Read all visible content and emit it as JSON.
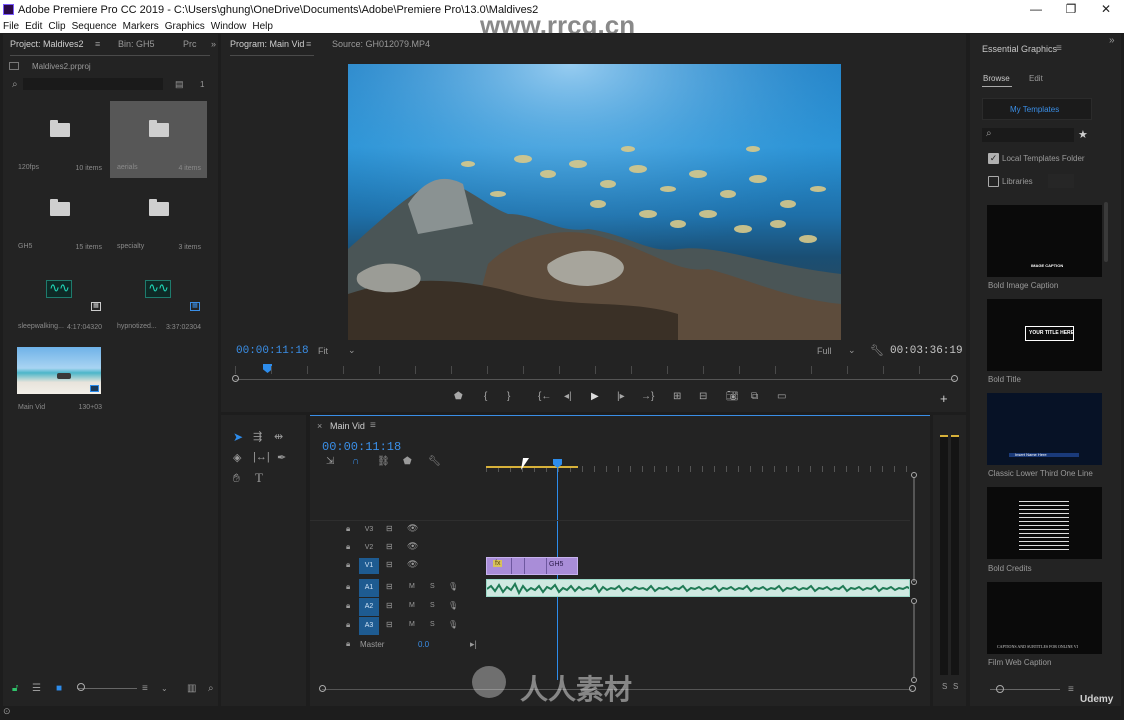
{
  "window": {
    "title": "Adobe Premiere Pro CC 2019 - C:\\Users\\ghung\\OneDrive\\Documents\\Adobe\\Premiere Pro\\13.0\\Maldives2",
    "minimize": "—",
    "restore": "❐",
    "close": "✕"
  },
  "menu": [
    "File",
    "Edit",
    "Clip",
    "Sequence",
    "Markers",
    "Graphics",
    "Window",
    "Help"
  ],
  "project": {
    "tabs": [
      "Project: Maldives2",
      "Bin: GH5",
      "Prc"
    ],
    "file": "Maldives2.prproj",
    "items_count": "1",
    "bins": [
      {
        "name": "120fps",
        "count": "10 items"
      },
      {
        "name": "aerials",
        "count": "4 items"
      },
      {
        "name": "GH5",
        "count": "15 items"
      },
      {
        "name": "specialty",
        "count": "3 items"
      },
      {
        "name": "sleepwalking...",
        "count": "4:17:04320"
      },
      {
        "name": "hypnotized...",
        "count": "3:37:02304"
      },
      {
        "name": "Main Vid",
        "count": "130+03"
      }
    ]
  },
  "program": {
    "tabs": [
      "Program: Main Vid",
      "Source: GH012079.MP4"
    ],
    "timecode": "00:00:11:18",
    "fit": "Fit",
    "quality": "Full",
    "duration": "00:03:36:19"
  },
  "timeline": {
    "tab": "Main Vid",
    "timecode": "00:00:11:18",
    "tracks": [
      {
        "label": "V3",
        "type": "video",
        "active": false
      },
      {
        "label": "V2",
        "type": "video",
        "active": false
      },
      {
        "label": "V1",
        "type": "video",
        "active": true
      },
      {
        "label": "A1",
        "type": "audio",
        "active": true
      },
      {
        "label": "A2",
        "type": "audio",
        "active": true
      },
      {
        "label": "A3",
        "type": "audio",
        "active": true
      }
    ],
    "master": {
      "label": "Master",
      "value": "0.0"
    },
    "clip_label": "GH5",
    "audio_mute": "M",
    "audio_solo": "S"
  },
  "essential_graphics": {
    "title": "Essential Graphics",
    "tabs": [
      "Browse",
      "Edit"
    ],
    "dropdown": "My Templates",
    "local_templates": "Local Templates Folder",
    "libraries": "Libraries",
    "templates": [
      {
        "name": "Bold Image Caption",
        "overlay": "IMAGE CAPTION"
      },
      {
        "name": "Bold Title",
        "overlay": "YOUR TITLE HERE"
      },
      {
        "name": "Classic Lower Third One Line",
        "overlay": "Insert Name Here"
      },
      {
        "name": "Bold Credits",
        "overlay": ""
      },
      {
        "name": "Film Web Caption",
        "overlay": "CAPTIONS AND SUBTITLES FOR ONLINE VI"
      }
    ]
  },
  "meters": {
    "s1": "S",
    "s2": "S"
  },
  "watermark": {
    "site": "www.rrcg.cn",
    "logo": "人人素材",
    "brand": "Udemy"
  },
  "colors": {
    "accent": "#2d8ceb",
    "audio": "#20d7b8",
    "clip": "#a98dd8",
    "bg": "#1d1d1d"
  }
}
